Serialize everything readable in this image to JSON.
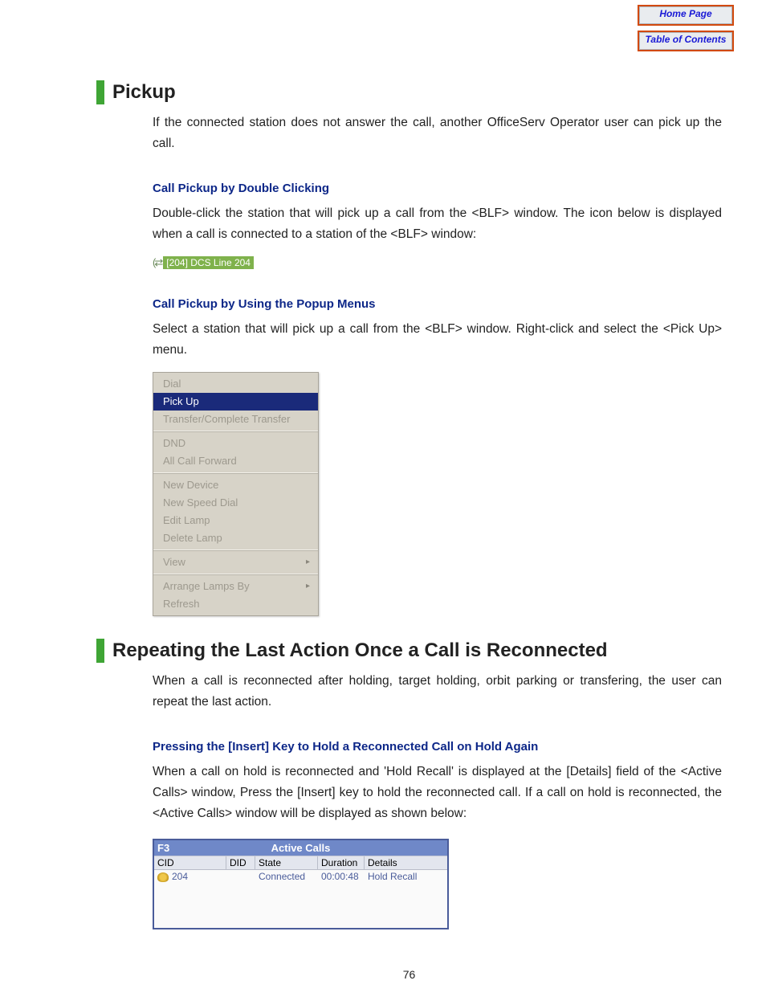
{
  "nav": {
    "home": "Home Page",
    "toc": "Table of Contents"
  },
  "section1": {
    "title": "Pickup",
    "intro": "If the connected station does not answer the call, another OfficeServ Operator user can pick up the call.",
    "sub1": {
      "title": "Call Pickup by Double Clicking",
      "text": "Double-click the station that will pick up a call from the <BLF> window. The icon below is displayed when a call is connected to a station of the <BLF> window:"
    },
    "blf_chip": "[204] DCS Line 204",
    "sub2": {
      "title": "Call Pickup by Using the Popup Menus",
      "text": "Select a station that will pick up a call from the <BLF> window. Right-click and select the <Pick Up> menu."
    }
  },
  "popup_menu": {
    "g1": [
      "Dial",
      "Pick Up",
      "Transfer/Complete Transfer"
    ],
    "g2": [
      "DND",
      "All Call Forward"
    ],
    "g3": [
      "New Device",
      "New Speed Dial",
      "Edit Lamp",
      "Delete Lamp"
    ],
    "g4": [
      "View"
    ],
    "g5": [
      "Arrange Lamps By",
      "Refresh"
    ]
  },
  "section2": {
    "title": "Repeating the Last Action Once a Call is Reconnected",
    "intro": "When a call is reconnected after holding, target holding, orbit parking or transfering, the user can repeat the last action.",
    "sub1": {
      "title": "Pressing the [Insert] Key to Hold a Reconnected Call on Hold Again",
      "text": "When a call on hold is reconnected and 'Hold Recall' is displayed at the [Details] field of the <Active Calls> window, Press the [Insert] key to hold the reconnected call. If a call on hold is reconnected, the <Active Calls> window will be displayed as shown below:"
    }
  },
  "active_calls": {
    "shortcut": "F3",
    "title": "Active Calls",
    "headers": {
      "cid": "CID",
      "did": "DID",
      "state": "State",
      "duration": "Duration",
      "details": "Details"
    },
    "row": {
      "cid": "204",
      "did": "",
      "state": "Connected",
      "duration": "00:00:48",
      "details": "Hold Recall"
    }
  },
  "page_number": "76"
}
